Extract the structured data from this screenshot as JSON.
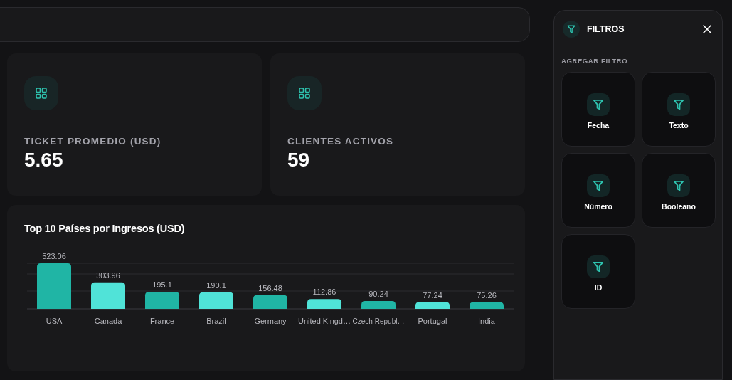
{
  "kpis": [
    {
      "label": "TICKET PROMEDIO (USD)",
      "value": "5.65"
    },
    {
      "label": "CLIENTES ACTIVOS",
      "value": "59"
    }
  ],
  "chart": {
    "chart_data": {
      "type": "bar",
      "title": "Top 10 Países por Ingresos (USD)",
      "categories": [
        "USA",
        "Canada",
        "France",
        "Brazil",
        "Germany",
        "United Kingd…",
        "Czech Republ…",
        "Portugal",
        "India"
      ],
      "series": [
        {
          "color": "#20b5a5",
          "values": [
            523.06,
            null,
            195.1,
            null,
            156.48,
            null,
            90.24,
            null,
            75.26
          ]
        },
        {
          "color": "#50e3d8",
          "values": [
            null,
            303.96,
            null,
            190.1,
            null,
            112.86,
            null,
            77.24,
            null
          ]
        }
      ],
      "ylim": [
        0,
        523.06
      ],
      "stacked": true,
      "data_labels": true
    }
  },
  "filters_panel": {
    "title": "FILTROS",
    "section_label": "AGREGAR FILTRO",
    "filters": [
      {
        "label": "Fecha"
      },
      {
        "label": "Texto"
      },
      {
        "label": "Número"
      },
      {
        "label": "Booleano"
      },
      {
        "label": "ID"
      }
    ]
  }
}
